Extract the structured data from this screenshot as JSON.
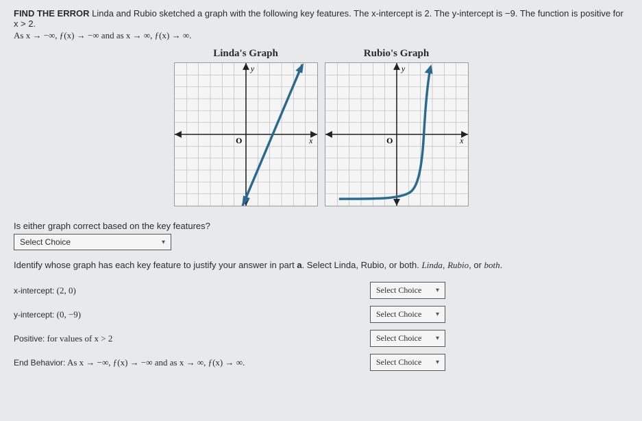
{
  "header": {
    "tag": "FIND THE ERROR",
    "line1_rest": " Linda and Rubio sketched a graph with the following key features. The x-intercept is 2. The y-intercept is −9. The function is positive for x > 2.",
    "line2": "As x → −∞, ƒ(x) → −∞ and as x → ∞, ƒ(x) → ∞."
  },
  "graphs": {
    "linda_title": "Linda's Graph",
    "rubio_title": "Rubio's Graph",
    "y_label": "y",
    "x_label": "x",
    "origin_label": "O"
  },
  "questionA": {
    "text": "Is either graph correct based on the key features?",
    "select_placeholder": "Select Choice"
  },
  "identify": {
    "text_prefix": "Identify whose graph has each key feature to justify your answer in part ",
    "part": "a",
    "text_suffix": ". Select Linda, Rubio, or both."
  },
  "features": [
    {
      "tag": "x-intercept:",
      "math": "(2, 0)"
    },
    {
      "tag": "y-intercept:",
      "math": "(0, −9)"
    },
    {
      "tag": "Positive:",
      "math": "for values of x > 2"
    },
    {
      "tag": "End Behavior:",
      "math": "As x → −∞, ƒ(x) → −∞ and as x → ∞, ƒ(x) → ∞."
    }
  ],
  "select_label": "Select Choice",
  "chart_data": [
    {
      "type": "line",
      "title": "Linda's Graph",
      "xlabel": "x",
      "ylabel": "y",
      "xlim": [
        -6,
        6
      ],
      "ylim": [
        -10,
        10
      ],
      "description": "Straight line through approx (2,0) and (0,-9), positive slope, extends to ±∞",
      "series": [
        {
          "name": "line",
          "points": [
            [
              -1,
              -13.5
            ],
            [
              5,
              13.5
            ]
          ]
        }
      ]
    },
    {
      "type": "line",
      "title": "Rubio's Graph",
      "xlabel": "x",
      "ylabel": "y",
      "xlim": [
        -6,
        6
      ],
      "ylim": [
        -10,
        10
      ],
      "description": "Curve: flat near y≈-9 for x<1, rises steeply through (2,0) then up to +∞; left tail stays near -9 (does not go to -∞)",
      "series": [
        {
          "name": "curve",
          "points": [
            [
              -5,
              -9
            ],
            [
              -2,
              -9
            ],
            [
              0,
              -9
            ],
            [
              1,
              -8.5
            ],
            [
              1.6,
              -6
            ],
            [
              2,
              0
            ],
            [
              2.3,
              6
            ],
            [
              2.6,
              12
            ]
          ]
        }
      ]
    }
  ]
}
